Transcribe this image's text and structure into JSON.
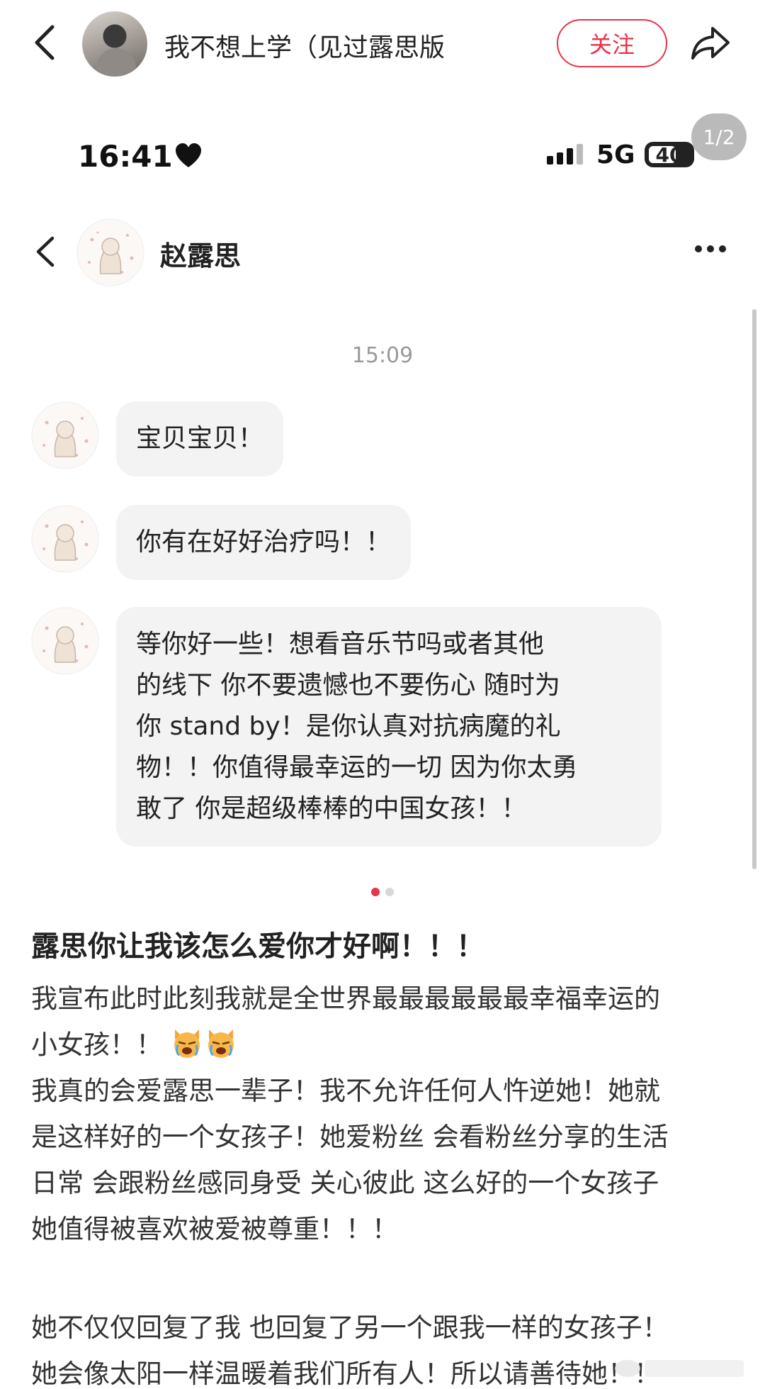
{
  "topbar": {
    "author_name": "我不想上学（见过露思版",
    "follow_label": "关注"
  },
  "image_counter": "1/2",
  "phone_status": {
    "time": "16:41",
    "network": "5G",
    "battery": "40"
  },
  "chat": {
    "contact_name": "赵露思",
    "timestamp": "15:09",
    "messages": [
      {
        "lines": [
          "宝贝宝贝！"
        ]
      },
      {
        "lines": [
          "你有在好好治疗吗！！"
        ]
      },
      {
        "lines": [
          "等你好一些！想看音乐节吗或者其他",
          "的线下 你不要遗憾也不要伤心 随时为",
          "你 stand by！是你认真对抗病魔的礼",
          "物！！你值得最幸运的一切 因为你太勇",
          "敢了 你是超级棒棒的中国女孩！！"
        ]
      }
    ]
  },
  "carousel": {
    "count": 2,
    "active": 0
  },
  "post": {
    "title": "露思你让我该怎么爱你才好啊！！！",
    "paragraph1": [
      "我宣布此时此刻我就是全世界最最最最最最幸福幸运的",
      "小女孩！！"
    ],
    "paragraph2": [
      "我真的会爱露思一辈子！我不允许任何人忤逆她！她就",
      "是这样好的一个女孩子！她爱粉丝 会看粉丝分享的生活",
      "日常 会跟粉丝感同身受 关心彼此 这么好的一个女孩子",
      "她值得被喜欢被爱被尊重！！！"
    ],
    "paragraph3": [
      "她不仅仅回复了我 也回复了另一个跟我一样的女孩子！",
      "她会像太阳一样温暖着我们所有人！所以请善待她！！"
    ],
    "emoji": "crying-cat-emoji"
  },
  "colors": {
    "accent": "#e8334a",
    "bubble": "#f3f3f3"
  }
}
